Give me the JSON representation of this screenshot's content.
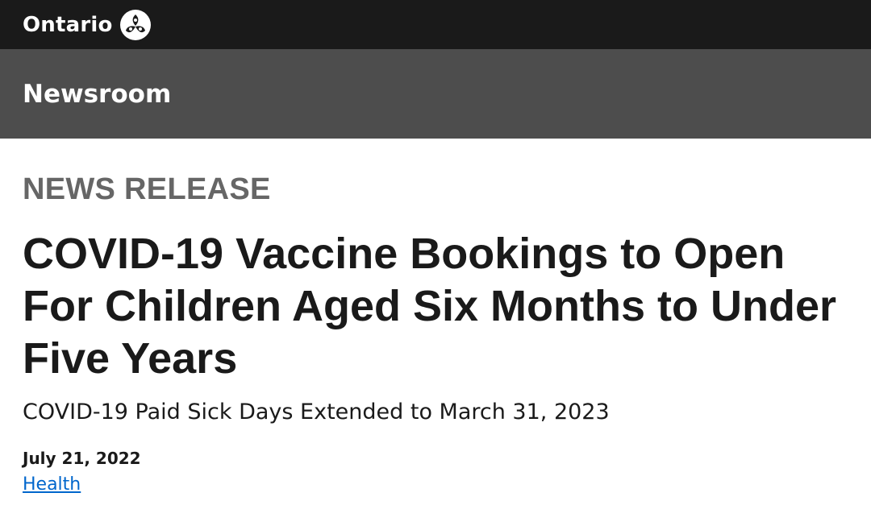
{
  "header": {
    "brand_text": "Ontario",
    "logo_icon": "ontario-trillium-icon"
  },
  "subheader": {
    "section": "Newsroom"
  },
  "article": {
    "kicker": "NEWS RELEASE",
    "title": "COVID-19 Vaccine Bookings to Open For Children Aged Six Months to Under Five Years",
    "subtitle": "COVID-19 Paid Sick Days Extended to March 31, 2023",
    "date": "July 21, 2022",
    "topic_link": "Health"
  },
  "colors": {
    "topbar": "#1a1a1a",
    "subbar": "#4d4d4d",
    "kicker": "#666666",
    "link": "#0066cc"
  }
}
